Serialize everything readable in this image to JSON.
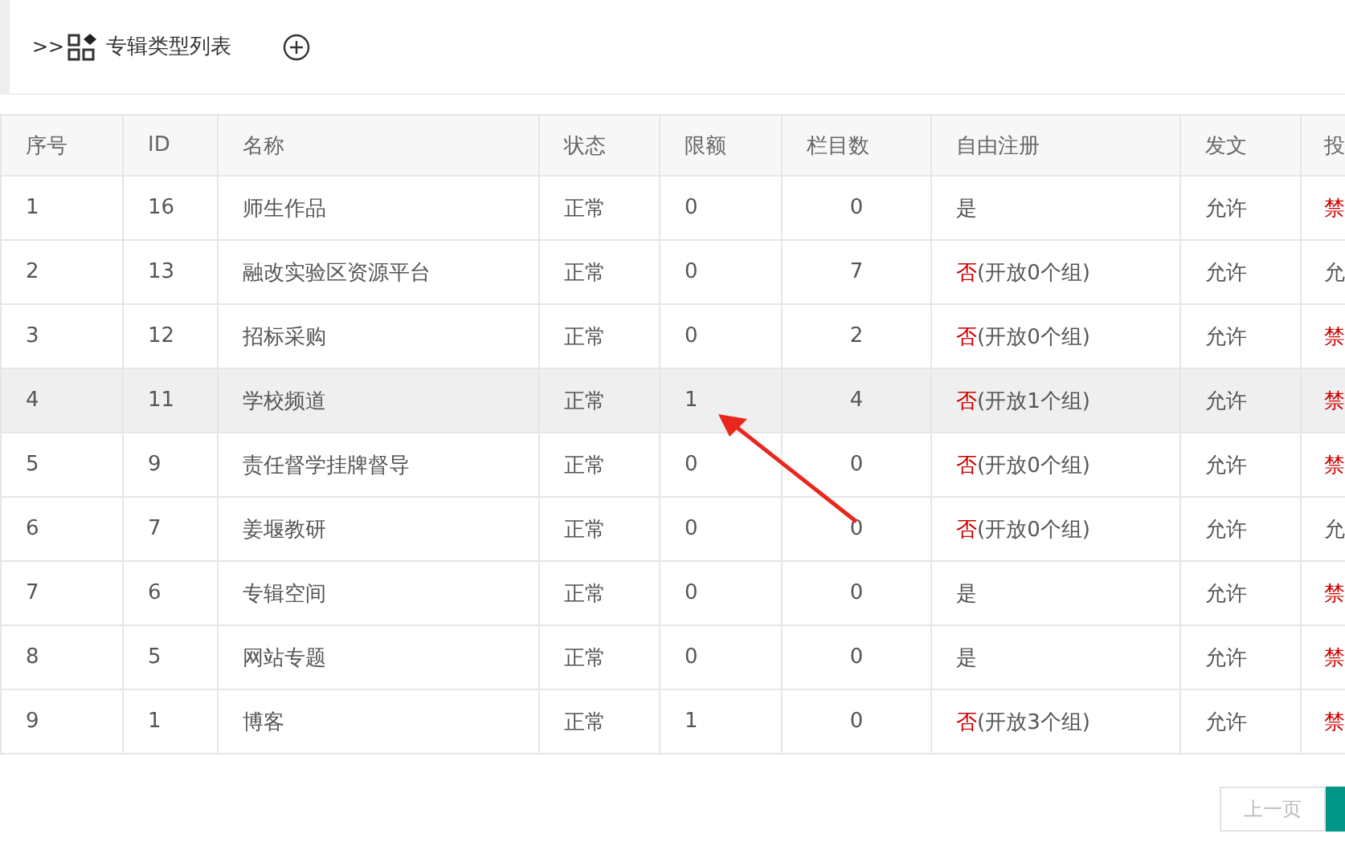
{
  "header": {
    "prefix": ">>",
    "title": "专辑类型列表"
  },
  "table": {
    "columns": [
      "序号",
      "ID",
      "名称",
      "状态",
      "限额",
      "栏目数",
      "自由注册",
      "发文",
      "投"
    ],
    "rows": [
      {
        "index": "1",
        "id": "16",
        "name": "师生作品",
        "status": "正常",
        "quota": "0",
        "sections": "0",
        "reg": "是",
        "reg_open": true,
        "reg_note": "",
        "publish": "允许",
        "post": "禁",
        "post_allowed": false,
        "selected": false
      },
      {
        "index": "2",
        "id": "13",
        "name": "融改实验区资源平台",
        "status": "正常",
        "quota": "0",
        "sections": "7",
        "reg": "否",
        "reg_open": false,
        "reg_note": "(开放0个组)",
        "publish": "允许",
        "post": "允",
        "post_allowed": true,
        "selected": false
      },
      {
        "index": "3",
        "id": "12",
        "name": "招标采购",
        "status": "正常",
        "quota": "0",
        "sections": "2",
        "reg": "否",
        "reg_open": false,
        "reg_note": "(开放0个组)",
        "publish": "允许",
        "post": "禁",
        "post_allowed": false,
        "selected": false
      },
      {
        "index": "4",
        "id": "11",
        "name": "学校频道",
        "status": "正常",
        "quota": "1",
        "sections": "4",
        "reg": "否",
        "reg_open": false,
        "reg_note": "(开放1个组)",
        "publish": "允许",
        "post": "禁",
        "post_allowed": false,
        "selected": true
      },
      {
        "index": "5",
        "id": "9",
        "name": "责任督学挂牌督导",
        "status": "正常",
        "quota": "0",
        "sections": "0",
        "reg": "否",
        "reg_open": false,
        "reg_note": "(开放0个组)",
        "publish": "允许",
        "post": "禁",
        "post_allowed": false,
        "selected": false
      },
      {
        "index": "6",
        "id": "7",
        "name": "姜堰教研",
        "status": "正常",
        "quota": "0",
        "sections": "0",
        "reg": "否",
        "reg_open": false,
        "reg_note": "(开放0个组)",
        "publish": "允许",
        "post": "允",
        "post_allowed": true,
        "selected": false
      },
      {
        "index": "7",
        "id": "6",
        "name": "专辑空间",
        "status": "正常",
        "quota": "0",
        "sections": "0",
        "reg": "是",
        "reg_open": true,
        "reg_note": "",
        "publish": "允许",
        "post": "禁",
        "post_allowed": false,
        "selected": false
      },
      {
        "index": "8",
        "id": "5",
        "name": "网站专题",
        "status": "正常",
        "quota": "0",
        "sections": "0",
        "reg": "是",
        "reg_open": true,
        "reg_note": "",
        "publish": "允许",
        "post": "禁",
        "post_allowed": false,
        "selected": false
      },
      {
        "index": "9",
        "id": "1",
        "name": "博客",
        "status": "正常",
        "quota": "1",
        "sections": "0",
        "reg": "否",
        "reg_open": false,
        "reg_note": "(开放3个组)",
        "publish": "允许",
        "post": "禁",
        "post_allowed": false,
        "selected": false
      }
    ]
  },
  "pagination": {
    "prev": "上一页"
  }
}
